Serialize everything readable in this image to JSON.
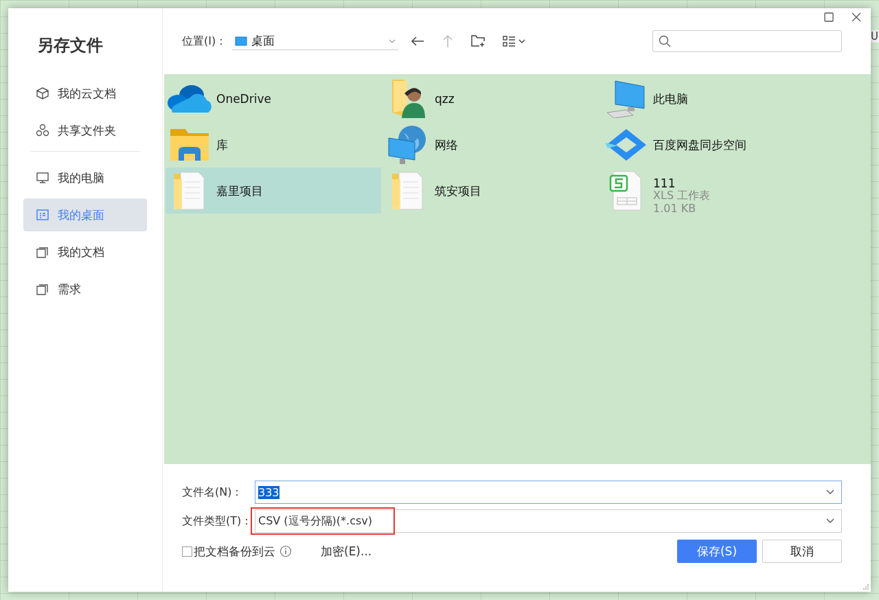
{
  "background": {
    "column_header": "U"
  },
  "title": "另存文件",
  "sidebar": {
    "groups": [
      [
        {
          "label": "我的云文档",
          "selected": false
        },
        {
          "label": "共享文件夹",
          "selected": false
        }
      ],
      [
        {
          "label": "我的电脑",
          "selected": false
        },
        {
          "label": "我的桌面",
          "selected": true
        },
        {
          "label": "我的文档",
          "selected": false
        },
        {
          "label": "需求",
          "selected": false
        }
      ]
    ]
  },
  "location": {
    "label": "位置(I)：",
    "value": "桌面"
  },
  "files": [
    {
      "name": "OneDrive",
      "selected": false
    },
    {
      "name": "qzz",
      "selected": false
    },
    {
      "name": "此电脑",
      "selected": false
    },
    {
      "name": "库",
      "selected": false
    },
    {
      "name": "网络",
      "selected": false
    },
    {
      "name": "百度网盘同步空间",
      "selected": false
    },
    {
      "name": "嘉里项目",
      "selected": true
    },
    {
      "name": "筑安项目",
      "selected": false
    },
    {
      "name": "111",
      "type": "XLS 工作表",
      "size": "1.01 KB",
      "selected": false
    }
  ],
  "filename": {
    "label": "文件名(N)：",
    "value": "333",
    "text_selected": true
  },
  "filetype": {
    "label": "文件类型(T)：",
    "value": "CSV (逗号分隔)(*.csv)",
    "highlighted": true
  },
  "backup": {
    "label": "把文档备份到云",
    "checked": false
  },
  "encrypt": "加密(E)...",
  "buttons": [
    {
      "label": "保存(S)",
      "kind": "primary"
    },
    {
      "label": "取消",
      "kind": "secondary"
    }
  ]
}
